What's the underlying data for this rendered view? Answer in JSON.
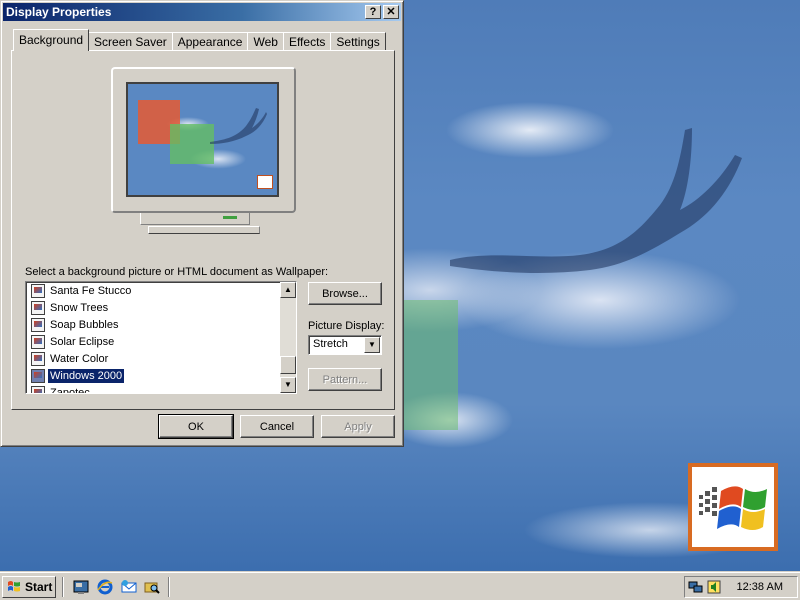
{
  "dialog": {
    "title": "Display Properties",
    "help_button": "?",
    "close_button": "✕",
    "tabs": [
      {
        "label": "Background",
        "active": true
      },
      {
        "label": "Screen Saver",
        "active": false
      },
      {
        "label": "Appearance",
        "active": false
      },
      {
        "label": "Web",
        "active": false
      },
      {
        "label": "Effects",
        "active": false
      },
      {
        "label": "Settings",
        "active": false
      }
    ],
    "background": {
      "select_label": "Select a background picture or HTML document as Wallpaper:",
      "wallpapers": [
        {
          "label": "Santa Fe Stucco",
          "selected": false
        },
        {
          "label": "Snow Trees",
          "selected": false
        },
        {
          "label": "Soap Bubbles",
          "selected": false
        },
        {
          "label": "Solar Eclipse",
          "selected": false
        },
        {
          "label": "Water Color",
          "selected": false
        },
        {
          "label": "Windows 2000",
          "selected": true
        },
        {
          "label": "Zapotec",
          "selected": false
        }
      ],
      "browse_label": "Browse...",
      "picture_display_label": "Picture Display:",
      "picture_display_value": "Stretch",
      "pattern_label": "Pattern..."
    },
    "footer": {
      "ok_label": "OK",
      "cancel_label": "Cancel",
      "apply_label": "Apply"
    }
  },
  "taskbar": {
    "start_label": "Start",
    "quick_launch": [
      "show-desktop-icon",
      "internet-explorer-icon",
      "outlook-express-icon",
      "windows-explorer-icon"
    ],
    "clock": "12:38 AM"
  },
  "colors": {
    "title_bar": "#0a246a",
    "selection": "#0a246a",
    "face": "#d4d0c8",
    "desktop": "#5a87c0"
  }
}
